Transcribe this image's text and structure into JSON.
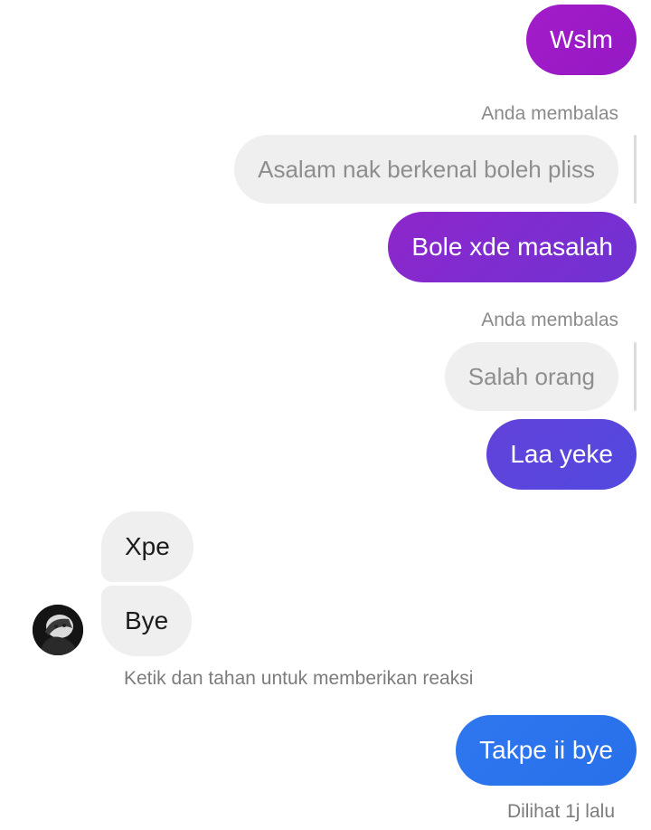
{
  "messages": {
    "m1": {
      "text": "Wslm"
    },
    "r1": {
      "label": "Anda membalas",
      "quoted": "Asalam nak berkenal boleh pliss"
    },
    "m2": {
      "text": "Bole xde masalah"
    },
    "r2": {
      "label": "Anda membalas",
      "quoted": "Salah orang"
    },
    "m3": {
      "text": "Laa yeke"
    },
    "in1": {
      "text": "Xpe"
    },
    "in2": {
      "text": "Bye"
    },
    "hint": "Ketik dan tahan untuk memberikan reaksi",
    "m4": {
      "text": "Takpe ii bye"
    },
    "seen": "Dilihat 1j lalu"
  },
  "colors": {
    "bubble_violet": "#a018c6",
    "bubble_purple": "#7b2fd0",
    "bubble_indigo": "#5b47dd",
    "bubble_blue": "#2b73ee",
    "incoming_bg": "#efefef"
  },
  "icons": {
    "avatar": "contact-avatar-photo"
  }
}
